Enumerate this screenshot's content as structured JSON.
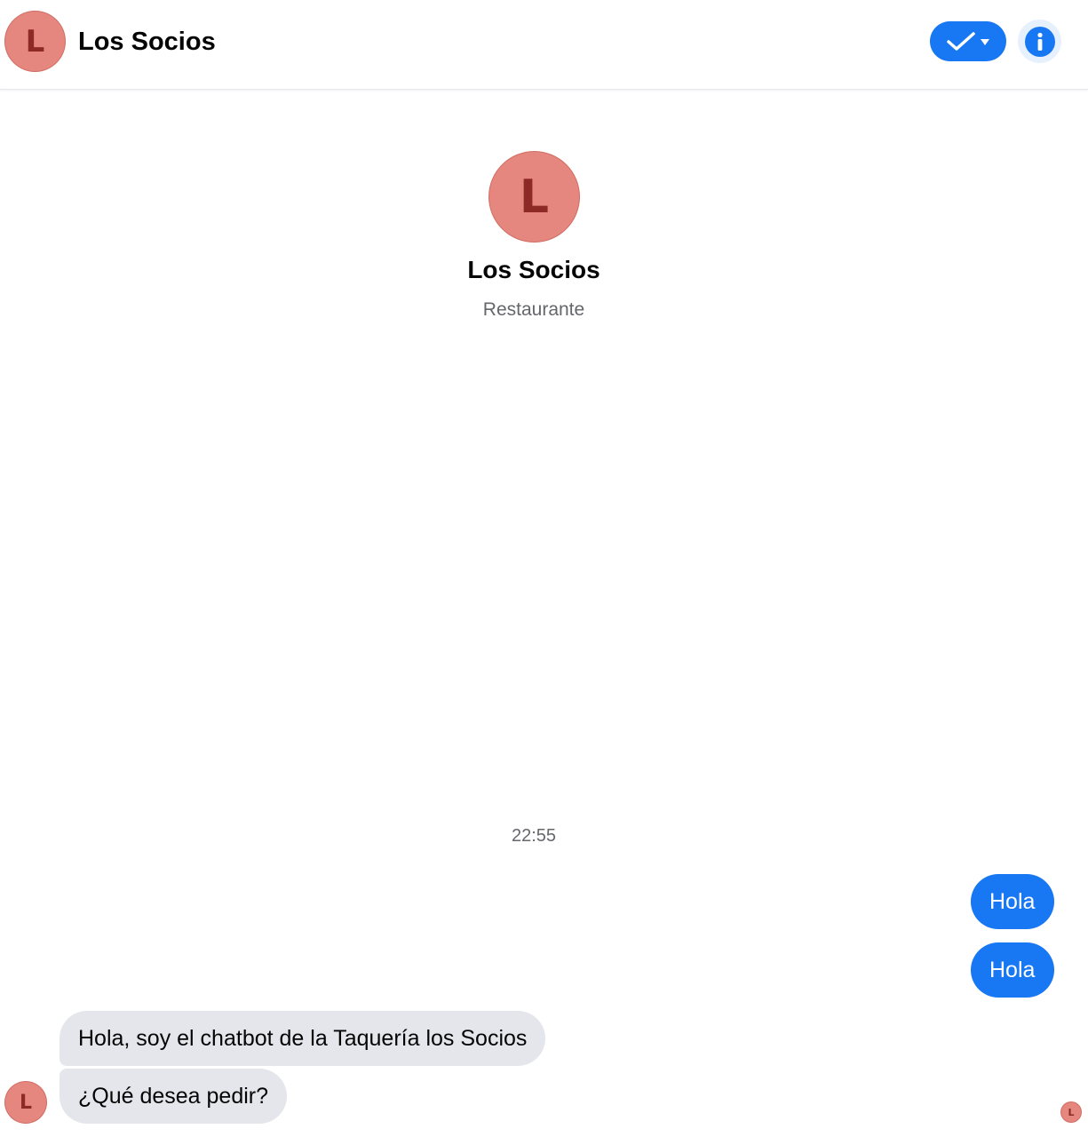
{
  "header": {
    "avatar_letter": "L",
    "title": "Los Socios",
    "status_icon": "check-icon",
    "dropdown_icon": "caret-down-icon",
    "info_icon": "info-icon"
  },
  "profile": {
    "avatar_letter": "L",
    "name": "Los Socios",
    "category": "Restaurante"
  },
  "conversation": {
    "timestamp": "22:55",
    "outgoing": [
      {
        "text": "Hola"
      },
      {
        "text": "Hola"
      }
    ],
    "incoming": [
      {
        "text": "Hola, soy el chatbot de la Taquería los Socios"
      },
      {
        "text": "¿Qué desea pedir?"
      }
    ],
    "sender_avatar_letter": "L",
    "seen_avatar_letter": "L"
  },
  "colors": {
    "accent": "#1877f2",
    "avatar_bg": "#e5877f",
    "avatar_letter": "#8e2a26",
    "incoming_bubble": "#e4e6eb",
    "muted_text": "#65676b"
  }
}
